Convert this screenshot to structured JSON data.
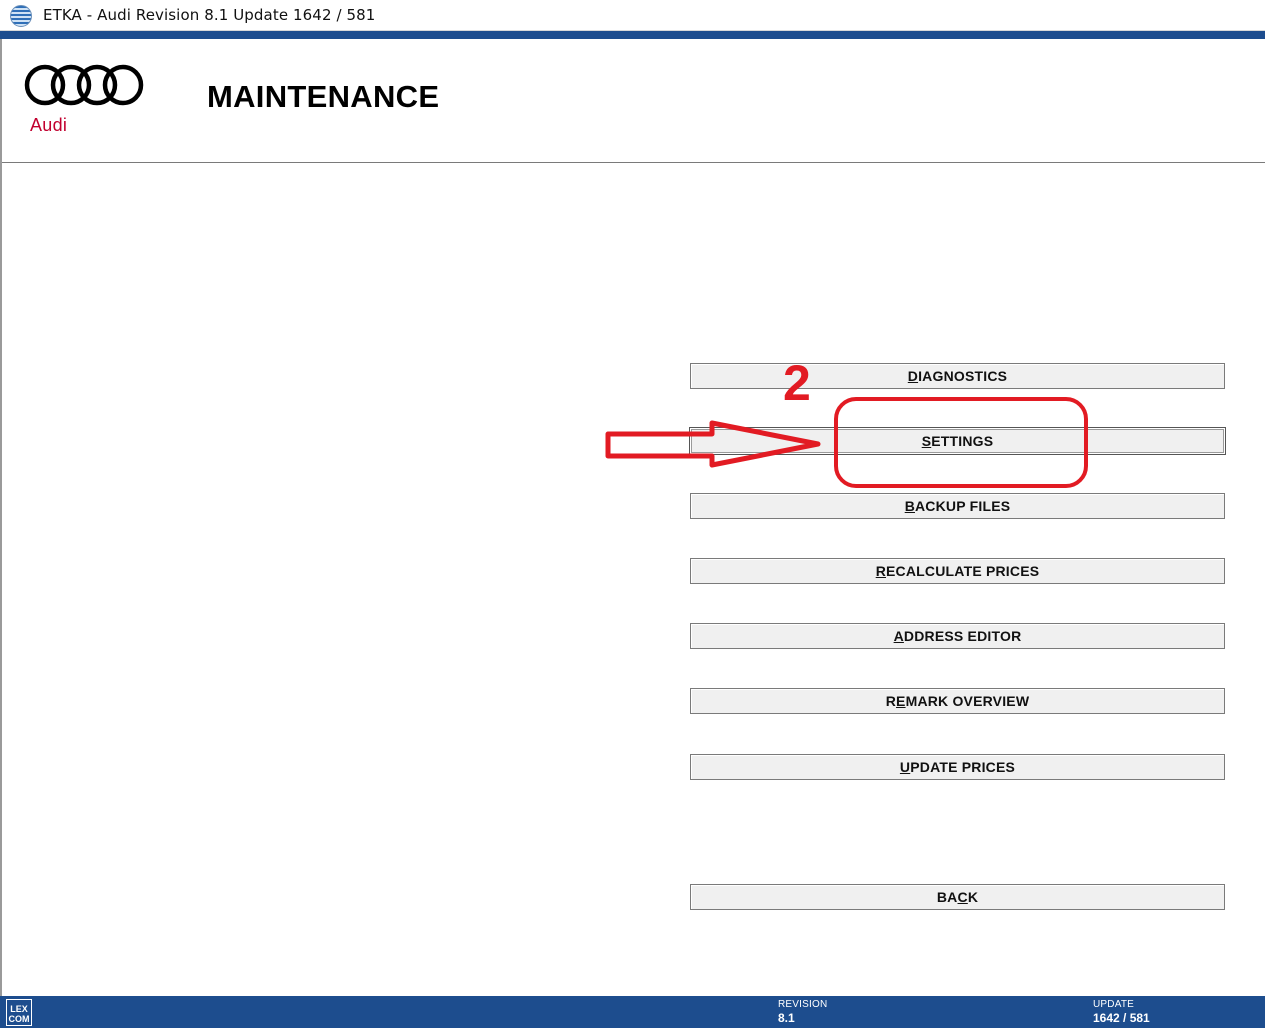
{
  "window": {
    "title": "ETKA - Audi Revision 8.1 Update 1642 / 581",
    "icon": "globe-icon"
  },
  "brand": {
    "logo_word": "Audi",
    "color": "#c2002f"
  },
  "header": {
    "title": "MAINTENANCE"
  },
  "menu": {
    "items": [
      {
        "name": "diagnostics",
        "pre": "",
        "key": "D",
        "post": "IAGNOSTICS"
      },
      {
        "name": "settings",
        "pre": "",
        "key": "S",
        "post": "ETTINGS"
      },
      {
        "name": "backup-files",
        "pre": "",
        "key": "B",
        "post": "ACKUP FILES"
      },
      {
        "name": "recalculate-prices",
        "pre": "",
        "key": "R",
        "post": "ECALCULATE PRICES"
      },
      {
        "name": "address-editor",
        "pre": "",
        "key": "A",
        "post": "DDRESS EDITOR"
      },
      {
        "name": "remark-overview",
        "pre": "R",
        "key": "E",
        "post": "MARK OVERVIEW"
      },
      {
        "name": "update-prices",
        "pre": "",
        "key": "U",
        "post": "PDATE PRICES"
      }
    ],
    "back": {
      "pre": "BA",
      "key": "C",
      "post": "K"
    }
  },
  "annotation": {
    "step_number": "2",
    "color": "#e21b23"
  },
  "statusbar": {
    "logo_line1": "LEX",
    "logo_line2": "COM",
    "revision_label": "REVISION",
    "revision_value": "8.1",
    "update_label": "UPDATE",
    "update_value": "1642 / 581",
    "color": "#1d4d8e"
  }
}
